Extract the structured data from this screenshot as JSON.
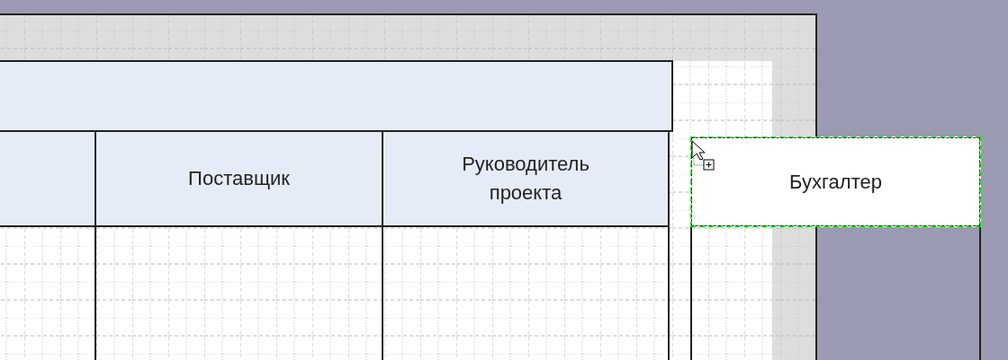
{
  "pool": {
    "kind": "pool"
  },
  "lanes": [
    {
      "kind": "lane"
    },
    {
      "kind": "lane",
      "label": "Поставщик"
    },
    {
      "kind": "lane",
      "label": "Руководитель проекта"
    }
  ],
  "dragged_lane": {
    "kind": "lane",
    "label": "Бухгалтер",
    "selected": true
  }
}
